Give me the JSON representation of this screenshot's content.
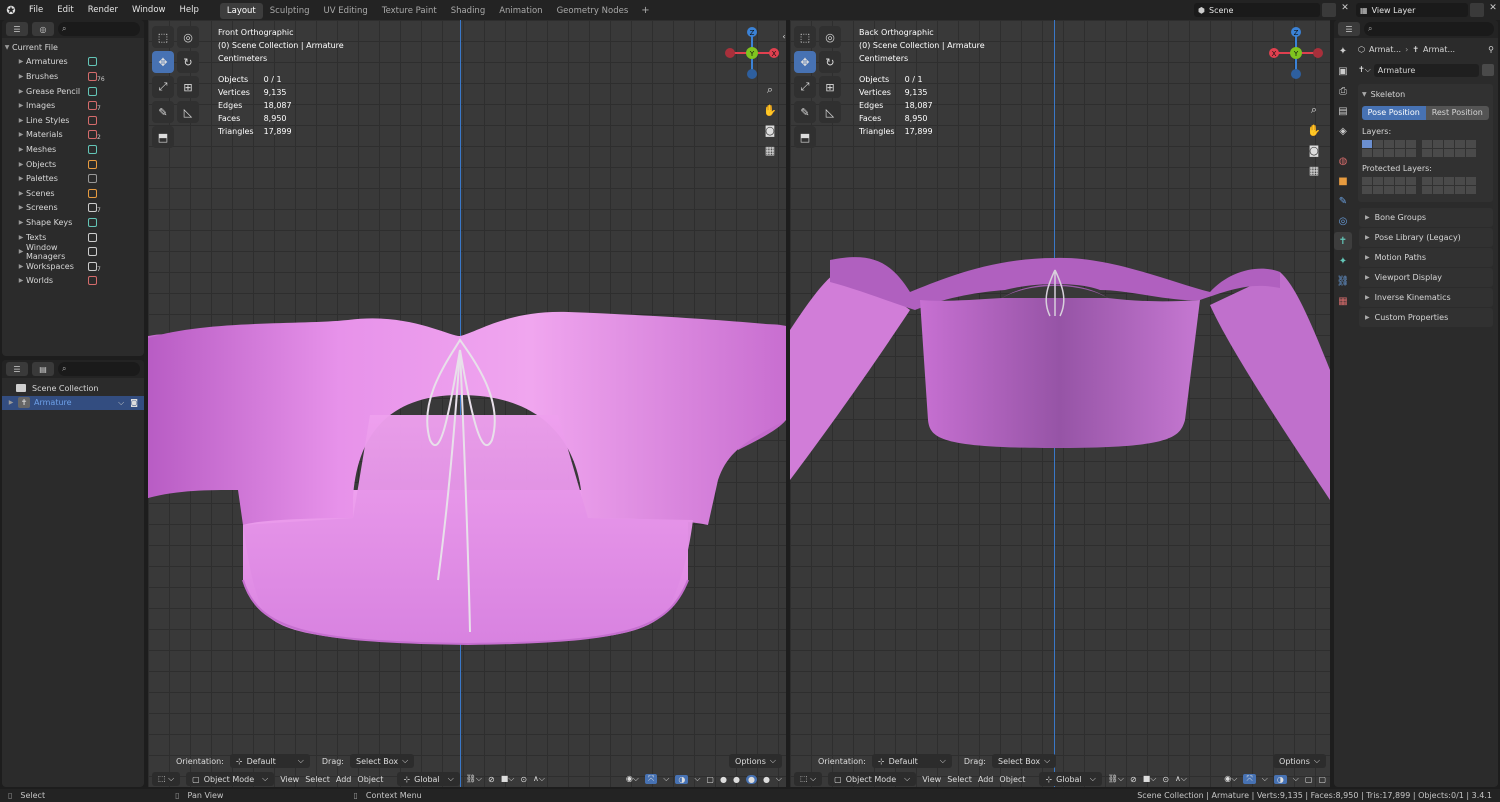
{
  "topbar": {
    "menus": [
      "File",
      "Edit",
      "Render",
      "Window",
      "Help"
    ],
    "workspaces": [
      "Layout",
      "Sculpting",
      "UV Editing",
      "Texture Paint",
      "Shading",
      "Animation",
      "Geometry Nodes"
    ],
    "add_tab": "+",
    "scene_label": "Scene",
    "view_layer_label": "View Layer"
  },
  "outliner_data": {
    "root": "Current File",
    "items": [
      {
        "label": "Armatures",
        "count": ""
      },
      {
        "label": "Brushes",
        "count": "76"
      },
      {
        "label": "Grease Pencil",
        "count": ""
      },
      {
        "label": "Images",
        "count": "7"
      },
      {
        "label": "Line Styles",
        "count": ""
      },
      {
        "label": "Materials",
        "count": "2"
      },
      {
        "label": "Meshes",
        "count": ""
      },
      {
        "label": "Objects",
        "count": ""
      },
      {
        "label": "Palettes",
        "count": ""
      },
      {
        "label": "Scenes",
        "count": ""
      },
      {
        "label": "Screens",
        "count": "7"
      },
      {
        "label": "Shape Keys",
        "count": ""
      },
      {
        "label": "Texts",
        "count": ""
      },
      {
        "label": "Window Managers",
        "count": ""
      },
      {
        "label": "Workspaces",
        "count": "7"
      },
      {
        "label": "Worlds",
        "count": ""
      }
    ]
  },
  "outliner_scene": {
    "collection": "Scene Collection",
    "armature": "Armature"
  },
  "viewport_left": {
    "view_name": "Front Orthographic",
    "collection_path": "(0) Scene Collection | Armature",
    "units": "Centimeters",
    "stats": [
      {
        "label": "Objects",
        "value": "0 / 1"
      },
      {
        "label": "Vertices",
        "value": "9,135"
      },
      {
        "label": "Edges",
        "value": "18,087"
      },
      {
        "label": "Faces",
        "value": "8,950"
      },
      {
        "label": "Triangles",
        "value": "17,899"
      }
    ]
  },
  "viewport_right": {
    "view_name": "Back Orthographic",
    "collection_path": "(0) Scene Collection | Armature",
    "units": "Centimeters",
    "stats": [
      {
        "label": "Objects",
        "value": "0 / 1"
      },
      {
        "label": "Vertices",
        "value": "9,135"
      },
      {
        "label": "Edges",
        "value": "18,087"
      },
      {
        "label": "Faces",
        "value": "8,950"
      },
      {
        "label": "Triangles",
        "value": "17,899"
      }
    ]
  },
  "gizmo": {
    "z": "Z",
    "y": "Y",
    "x": "X"
  },
  "viewport_footer": {
    "orientation_label": "Orientation:",
    "orientation_value": "Default",
    "drag_label": "Drag:",
    "drag_value": "Select Box",
    "options": "Options",
    "mode": "Object Mode",
    "menus": [
      "View",
      "Select",
      "Add",
      "Object"
    ],
    "transform": "Global"
  },
  "properties": {
    "breadcrumb_1": "Armat...",
    "breadcrumb_2": "Armat...",
    "object_name": "Armature",
    "skeleton_title": "Skeleton",
    "pose_position": "Pose Position",
    "rest_position": "Rest Position",
    "layers_label": "Layers:",
    "protected_label": "Protected Layers:",
    "sections": [
      "Bone Groups",
      "Pose Library (Legacy)",
      "Motion Paths",
      "Viewport Display",
      "Inverse Kinematics",
      "Custom Properties"
    ]
  },
  "statusbar": {
    "select": "Select",
    "pan_view": "Pan View",
    "context_menu": "Context Menu",
    "info": "Scene Collection | Armature | Verts:9,135 | Faces:8,950 | Tris:17,899 | Objects:0/1 | 3.4.1"
  },
  "colors": {
    "accent": "#4772b3",
    "garment": "#e18ae6",
    "garment_back": "#9a5aa8",
    "axis_x": "#e0404f",
    "axis_y": "#7fc41f",
    "axis_z": "#3b82d6"
  }
}
